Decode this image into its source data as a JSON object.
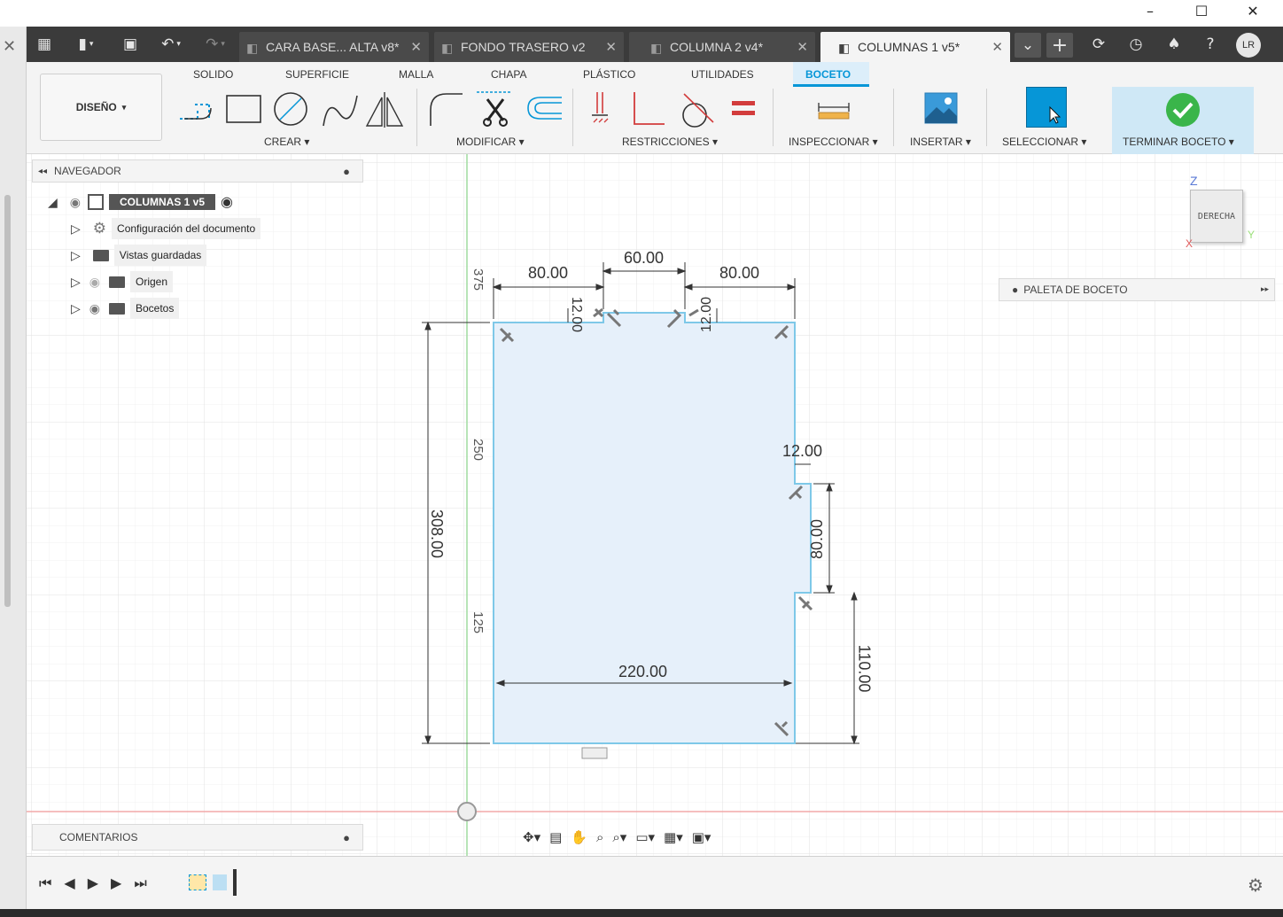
{
  "window": {
    "minimize": "–",
    "maximize": "☐",
    "close": "✕"
  },
  "left_close": "✕",
  "tabs": [
    {
      "label": "CARA BASE... ALTA v8*",
      "active": false
    },
    {
      "label": "FONDO TRASERO v2",
      "active": false
    },
    {
      "label": "COLUMNA 2 v4*",
      "active": false
    },
    {
      "label": "COLUMNAS 1 v5*",
      "active": true
    }
  ],
  "tab_close": "✕",
  "user_initials": "LR",
  "toolbar": {
    "workspace": "DISEÑO",
    "tabs": [
      "SOLIDO",
      "SUPERFICIE",
      "MALLA",
      "CHAPA",
      "PLÁSTICO",
      "UTILIDADES",
      "BOCETO"
    ],
    "active_tab": "BOCETO",
    "groups": {
      "crear": "CREAR ▾",
      "modificar": "MODIFICAR ▾",
      "restricciones": "RESTRICCIONES ▾",
      "inspeccionar": "INSPECCIONAR ▾",
      "insertar": "INSERTAR ▾",
      "seleccionar": "SELECCIONAR ▾",
      "terminar": "TERMINAR BOCETO ▾"
    }
  },
  "navigator": {
    "title": "NAVEGADOR",
    "root": "COLUMNAS 1 v5",
    "items": [
      {
        "label": "Configuración del documento"
      },
      {
        "label": "Vistas guardadas"
      },
      {
        "label": "Origen"
      },
      {
        "label": "Bocetos"
      }
    ]
  },
  "viewcube": {
    "face": "DERECHA",
    "z": "Z",
    "y": "Y",
    "x": "X"
  },
  "palette": {
    "title": "PALETA DE BOCETO"
  },
  "comments": {
    "title": "COMENTARIOS"
  },
  "dimensions": {
    "top_left": "80.00",
    "top_mid": "60.00",
    "top_right": "80.00",
    "notch_left": "12.00",
    "notch_right": "12.00",
    "side_notch": "12.00",
    "height_total": "308.00",
    "width": "220.00",
    "right_mid": "80.00",
    "right_bottom": "110.00",
    "ruler_375": "375",
    "ruler_250": "250",
    "ruler_125": "125"
  },
  "colors": {
    "accent": "#0696d7",
    "profile_fill": "#e6f0fa",
    "profile_stroke": "#7ec8e8",
    "terminar_bg": "#cfe8f6",
    "check_green": "#3ab54a"
  }
}
